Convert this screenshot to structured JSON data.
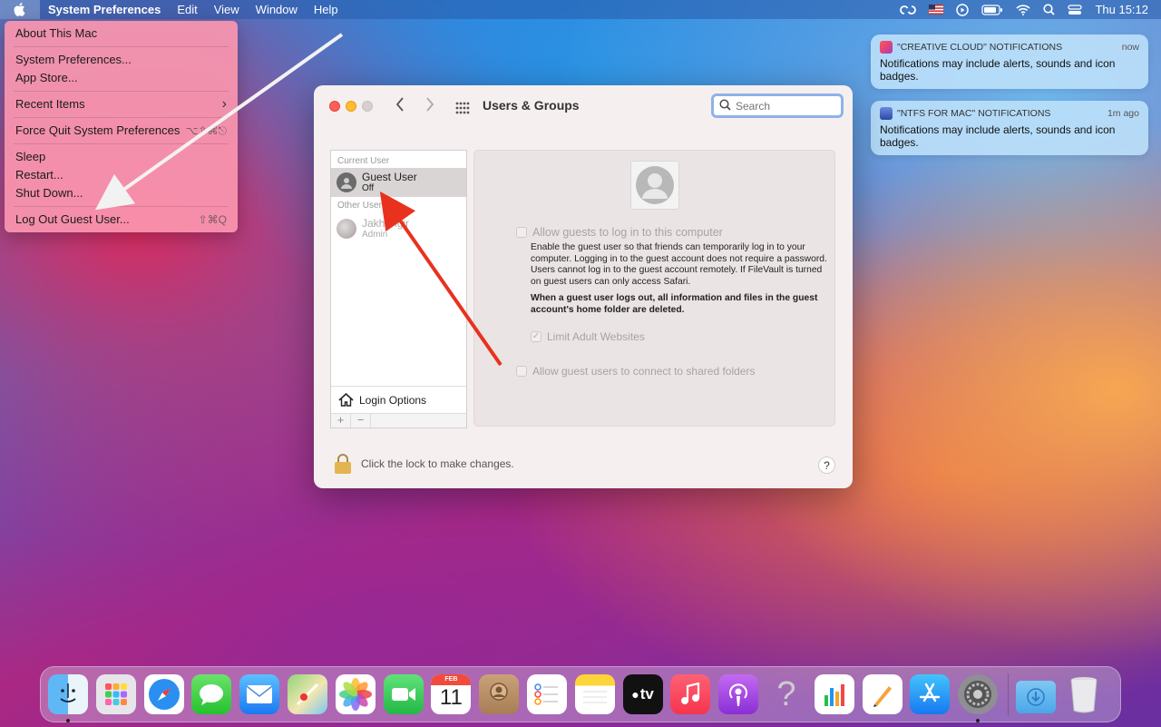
{
  "menubar": {
    "app_name": "System Preferences",
    "menus": [
      "Edit",
      "View",
      "Window",
      "Help"
    ],
    "clock": "Thu 15:12"
  },
  "apple_menu": {
    "items": [
      {
        "label": "About This Mac",
        "shortcut": ""
      },
      {
        "label": "System Preferences...",
        "shortcut": ""
      },
      {
        "label": "App Store...",
        "shortcut": ""
      },
      {
        "label": "Recent Items",
        "shortcut": "›"
      },
      {
        "label": "Force Quit System Preferences",
        "shortcut": "⌥⇧⌘⎋"
      },
      {
        "label": "Sleep",
        "shortcut": ""
      },
      {
        "label": "Restart...",
        "shortcut": ""
      },
      {
        "label": "Shut Down...",
        "shortcut": ""
      },
      {
        "label": "Log Out Guest User...",
        "shortcut": "⇧⌘Q"
      }
    ]
  },
  "window": {
    "title": "Users & Groups",
    "search_placeholder": "Search",
    "users": {
      "current_header": "Current User",
      "current_name": "Guest User",
      "current_status": "Off",
      "other_header": "Other Users",
      "other_name": "Jakhangir",
      "other_role": "Admin",
      "login_options": "Login Options"
    },
    "detail": {
      "allow_login_label": "Allow guests to log in to this computer",
      "description": "Enable the guest user so that friends can temporarily log in to your computer. Logging in to the guest account does not require a password. Users cannot log in to the guest account remotely. If FileVault is turned on guest users can only access Safari.",
      "warning": "When a guest user logs out, all information and files in the guest account's home folder are deleted.",
      "limit_label": "Limit Adult Websites",
      "shared_label": "Allow guest users to connect to shared folders"
    },
    "lock_text": "Click the lock to make changes.",
    "help_label": "?"
  },
  "notifications": [
    {
      "app": "\"CREATIVE CLOUD\" NOTIFICATIONS",
      "time": "now",
      "body": "Notifications may include alerts, sounds and icon badges.",
      "color": "#e0457a"
    },
    {
      "app": "\"NTFS FOR MAC\" NOTIFICATIONS",
      "time": "1m ago",
      "body": "Notifications may include alerts, sounds and icon badges.",
      "color": "#3b5db8"
    }
  ],
  "dock": {
    "calendar_month": "FEB",
    "calendar_day": "11",
    "tv_label": "tv",
    "help_glyph": "?"
  }
}
